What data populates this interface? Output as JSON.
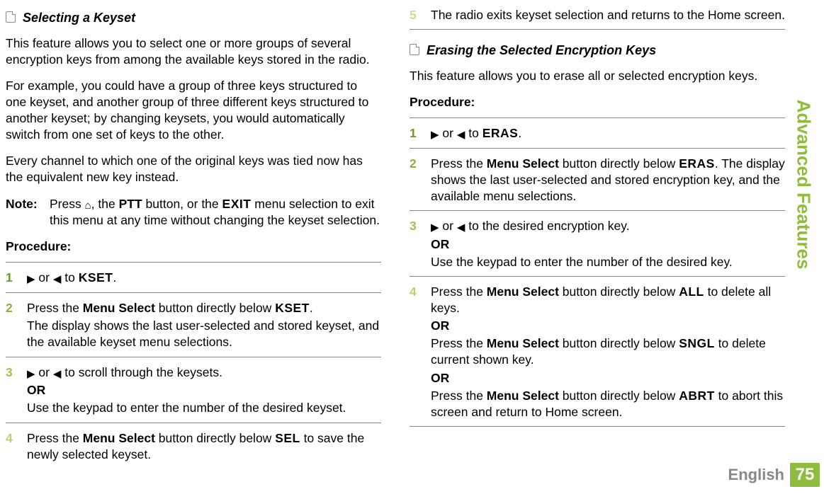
{
  "sidebar": {
    "title": "Advanced Features"
  },
  "footer": {
    "language": "English",
    "pageNumber": "75"
  },
  "left": {
    "sectionTitle": "Selecting a Keyset",
    "para1": "This feature allows you to select one or more groups of several encryption keys from among the available keys stored in the radio.",
    "para2": "For example, you could have a group of three keys structured to one keyset, and another group of three different keys structured to another keyset; by changing keysets, you would automatically switch from one set of keys to the other.",
    "para3": "Every channel to which one of the original keys was tied now has the equivalent new key instead.",
    "noteLabel": "Note:",
    "noteBodyA": "Press ",
    "noteBodyB": ", the ",
    "noteBodyPTT": "PTT",
    "noteBodyC": " button, or the ",
    "noteBodyMenu": "EXIT",
    "noteBodyD": " menu selection to exit this menu at any time without changing the keyset selection.",
    "procedure": "Procedure:",
    "steps": {
      "s1": {
        "num": "1",
        "a": " or ",
        "to": " to ",
        "kset": "KSET",
        "dot": "."
      },
      "s2": {
        "num": "2",
        "a": "Press the ",
        "b": "Menu Select",
        "c": " button directly below ",
        "kset": "KSET",
        "d": ".",
        "line2": "The display shows the last user-selected and stored keyset, and the available keyset menu selections."
      },
      "s3": {
        "num": "3",
        "a": " or ",
        "b": " to scroll through the keysets.",
        "or": "OR",
        "line2": "Use the keypad to enter the number of the desired keyset."
      },
      "s4": {
        "num": "4",
        "a": "Press the ",
        "b": "Menu Select",
        "c": " button directly below ",
        "sel": "SEL",
        "d": " to save the newly selected keyset."
      }
    }
  },
  "right": {
    "step5": {
      "num": "5",
      "text": "The radio exits keyset selection and returns to the Home screen."
    },
    "sectionTitle": "Erasing the Selected Encryption Keys",
    "para1": "This feature allows you to erase all or selected encryption keys.",
    "procedure": "Procedure:",
    "steps": {
      "s1": {
        "num": "1",
        "a": " or ",
        "to": " to ",
        "eras": "ERAS",
        "dot": "."
      },
      "s2": {
        "num": "2",
        "a": "Press the ",
        "b": "Menu Select",
        "c": " button directly below ",
        "eras": "ERAS",
        "d": ". The display shows the last user-selected and stored encryption key, and the available menu selections."
      },
      "s3": {
        "num": "3",
        "a": " or ",
        "b": " to the desired encryption key.",
        "or": "OR",
        "line2": "Use the keypad to enter the number of the desired key."
      },
      "s4": {
        "num": "4",
        "a": "Press the ",
        "b": "Menu Select",
        "c": " button directly below ",
        "all": "ALL",
        "d": " to delete all keys.",
        "or1": "OR",
        "line2a": "Press the ",
        "line2b": "Menu Select",
        "line2c": " button directly below ",
        "sngl": "SNGL",
        "line2d": " to delete current shown key.",
        "or2": "OR",
        "line3a": "Press the ",
        "line3b": "Menu Select",
        "line3c": " button directly below ",
        "abrt": "ABRT",
        "line3d": " to abort this screen and return to Home screen."
      }
    }
  }
}
